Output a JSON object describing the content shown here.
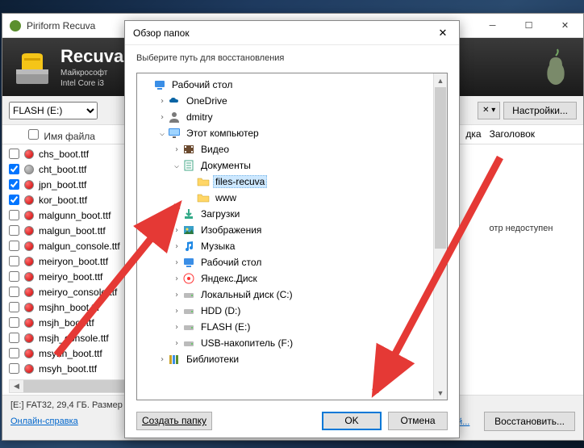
{
  "main_window": {
    "title": "Piriform Recuva",
    "header": {
      "app_name": "Recuva",
      "sys_line1": "Майкрософт",
      "sys_line2": "Intel Core i3"
    },
    "toolbar": {
      "drive_selected": "FLASH (E:)",
      "settings_btn": "Настройки..."
    },
    "columns": {
      "name": "Имя файла",
      "header2": "дка",
      "header3": "Заголовок"
    },
    "files": [
      {
        "name": "chs_boot.ttf",
        "checked": false,
        "status": "red"
      },
      {
        "name": "cht_boot.ttf",
        "checked": true,
        "status": "gray"
      },
      {
        "name": "jpn_boot.ttf",
        "checked": true,
        "status": "red"
      },
      {
        "name": "kor_boot.ttf",
        "checked": true,
        "status": "red"
      },
      {
        "name": "malgunn_boot.ttf",
        "checked": false,
        "status": "red"
      },
      {
        "name": "malgun_boot.ttf",
        "checked": false,
        "status": "red"
      },
      {
        "name": "malgun_console.ttf",
        "checked": false,
        "status": "red"
      },
      {
        "name": "meiryon_boot.ttf",
        "checked": false,
        "status": "red"
      },
      {
        "name": "meiryo_boot.ttf",
        "checked": false,
        "status": "red"
      },
      {
        "name": "meiryo_console.ttf",
        "checked": false,
        "status": "red"
      },
      {
        "name": "msjhn_boot.ttf",
        "checked": false,
        "status": "red"
      },
      {
        "name": "msjh_boot.ttf",
        "checked": false,
        "status": "red"
      },
      {
        "name": "msjh_console.ttf",
        "checked": false,
        "status": "red"
      },
      {
        "name": "msyhn_boot.ttf",
        "checked": false,
        "status": "red"
      },
      {
        "name": "msyh_boot.ttf",
        "checked": false,
        "status": "red"
      }
    ],
    "preview_text": "отр недоступен",
    "status_bar": "[E:] FAT32, 29,4 ГБ. Размер",
    "footer": {
      "help_link": "Онлайн-справка",
      "updates_link": "Проверка обновлений...",
      "restore_btn": "Восстановить..."
    }
  },
  "dialog": {
    "title": "Обзор папок",
    "subtitle": "Выберите путь для восстановления",
    "tree": [
      {
        "level": 0,
        "exp": "",
        "icon": "desktop",
        "label": "Рабочий стол"
      },
      {
        "level": 1,
        "exp": ">",
        "icon": "onedrive",
        "label": "OneDrive"
      },
      {
        "level": 1,
        "exp": ">",
        "icon": "user",
        "label": "dmitry"
      },
      {
        "level": 1,
        "exp": "v",
        "icon": "monitor",
        "label": "Этот компьютер"
      },
      {
        "level": 2,
        "exp": ">",
        "icon": "video",
        "label": "Видео"
      },
      {
        "level": 2,
        "exp": "v",
        "icon": "docs",
        "label": "Документы"
      },
      {
        "level": 3,
        "exp": "",
        "icon": "folder",
        "label": "files-recuva",
        "selected": true
      },
      {
        "level": 3,
        "exp": "",
        "icon": "folder",
        "label": "www"
      },
      {
        "level": 2,
        "exp": ">",
        "icon": "downloads",
        "label": "Загрузки"
      },
      {
        "level": 2,
        "exp": ">",
        "icon": "images",
        "label": "Изображения"
      },
      {
        "level": 2,
        "exp": ">",
        "icon": "music",
        "label": "Музыка"
      },
      {
        "level": 2,
        "exp": ">",
        "icon": "desktop2",
        "label": "Рабочий стол"
      },
      {
        "level": 2,
        "exp": ">",
        "icon": "yadisk",
        "label": "Яндекс.Диск"
      },
      {
        "level": 2,
        "exp": ">",
        "icon": "drive",
        "label": "Локальный диск (C:)"
      },
      {
        "level": 2,
        "exp": ">",
        "icon": "drive",
        "label": "HDD (D:)"
      },
      {
        "level": 2,
        "exp": ">",
        "icon": "drive",
        "label": "FLASH (E:)"
      },
      {
        "level": 2,
        "exp": ">",
        "icon": "drive",
        "label": "USB-накопитель (F:)"
      },
      {
        "level": 1,
        "exp": ">",
        "icon": "libs",
        "label": "Библиотеки"
      }
    ],
    "buttons": {
      "new_folder": "Создать папку",
      "ok": "OK",
      "cancel": "Отмена"
    }
  }
}
